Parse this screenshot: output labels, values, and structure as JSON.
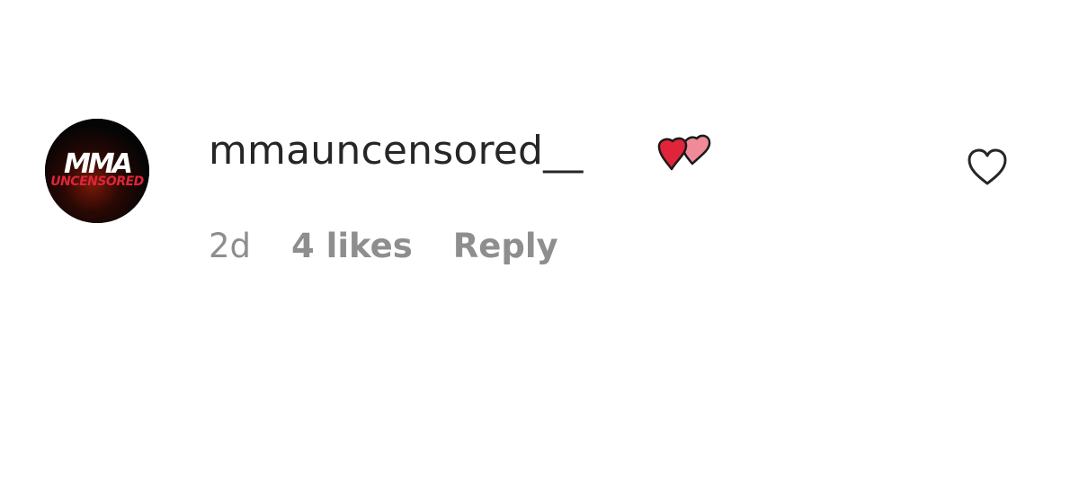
{
  "comment": {
    "avatar_logo_top": "MMA",
    "avatar_logo_bottom": "UNCENSORED",
    "username": "mmauncensored__",
    "emoji_icon": "two-hearts-icon",
    "time_ago": "2d",
    "likes": "4 likes",
    "reply_label": "Reply",
    "like_icon": "heart-outline-icon"
  },
  "colors": {
    "text": "#262626",
    "muted": "#8e8e8e",
    "heart_red": "#e0243a",
    "heart_pink": "#f08a98"
  }
}
